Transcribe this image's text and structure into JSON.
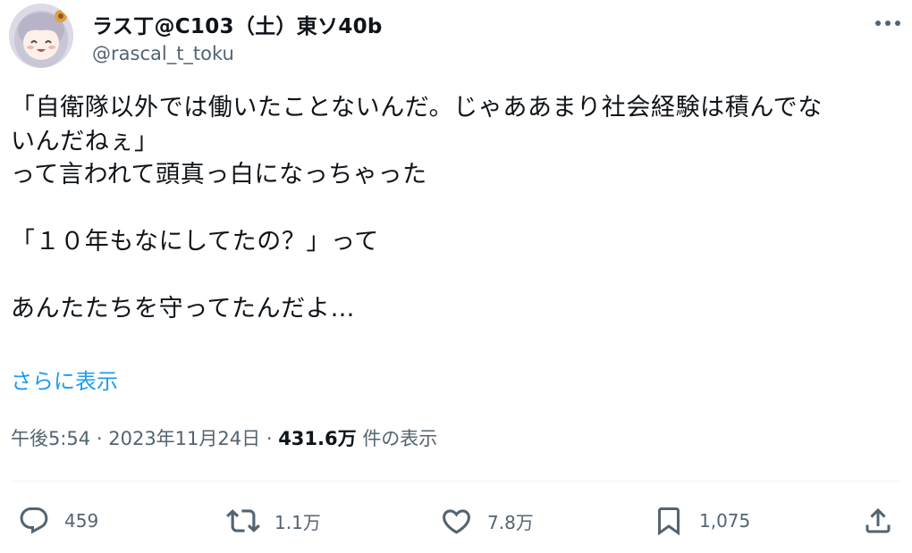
{
  "author": {
    "display_name": "ラス丁@C103（土）東ソ40b",
    "handle": "@rascal_t_toku"
  },
  "tweet": {
    "lines": [
      "「自衛隊以外では働いたことないんだ。じゃああまり社会経験は積んでな",
      "いんだねぇ」",
      "って言われて頭真っ白になっちゃった",
      "",
      "「１０年もなにしてたの？」って",
      "",
      "あんたたちを守ってたんだよ…"
    ],
    "show_more": "さらに表示"
  },
  "meta": {
    "time": "午後5:54",
    "separator": "·",
    "date": "2023年11月24日",
    "views_count": "431.6万",
    "views_label": "件の表示"
  },
  "actions": {
    "reply_count": "459",
    "retweet_count": "1.1万",
    "like_count": "7.8万",
    "bookmark_count": "1,075"
  },
  "icons": {
    "more": "more-dots-icon",
    "reply": "reply-bubble-icon",
    "retweet": "retweet-icon",
    "like": "heart-icon",
    "bookmark": "bookmark-icon",
    "share": "share-upload-icon"
  },
  "colors": {
    "text": "#0f1419",
    "secondary": "#536471",
    "link": "#1d9bf0",
    "divider": "#eff3f4"
  }
}
